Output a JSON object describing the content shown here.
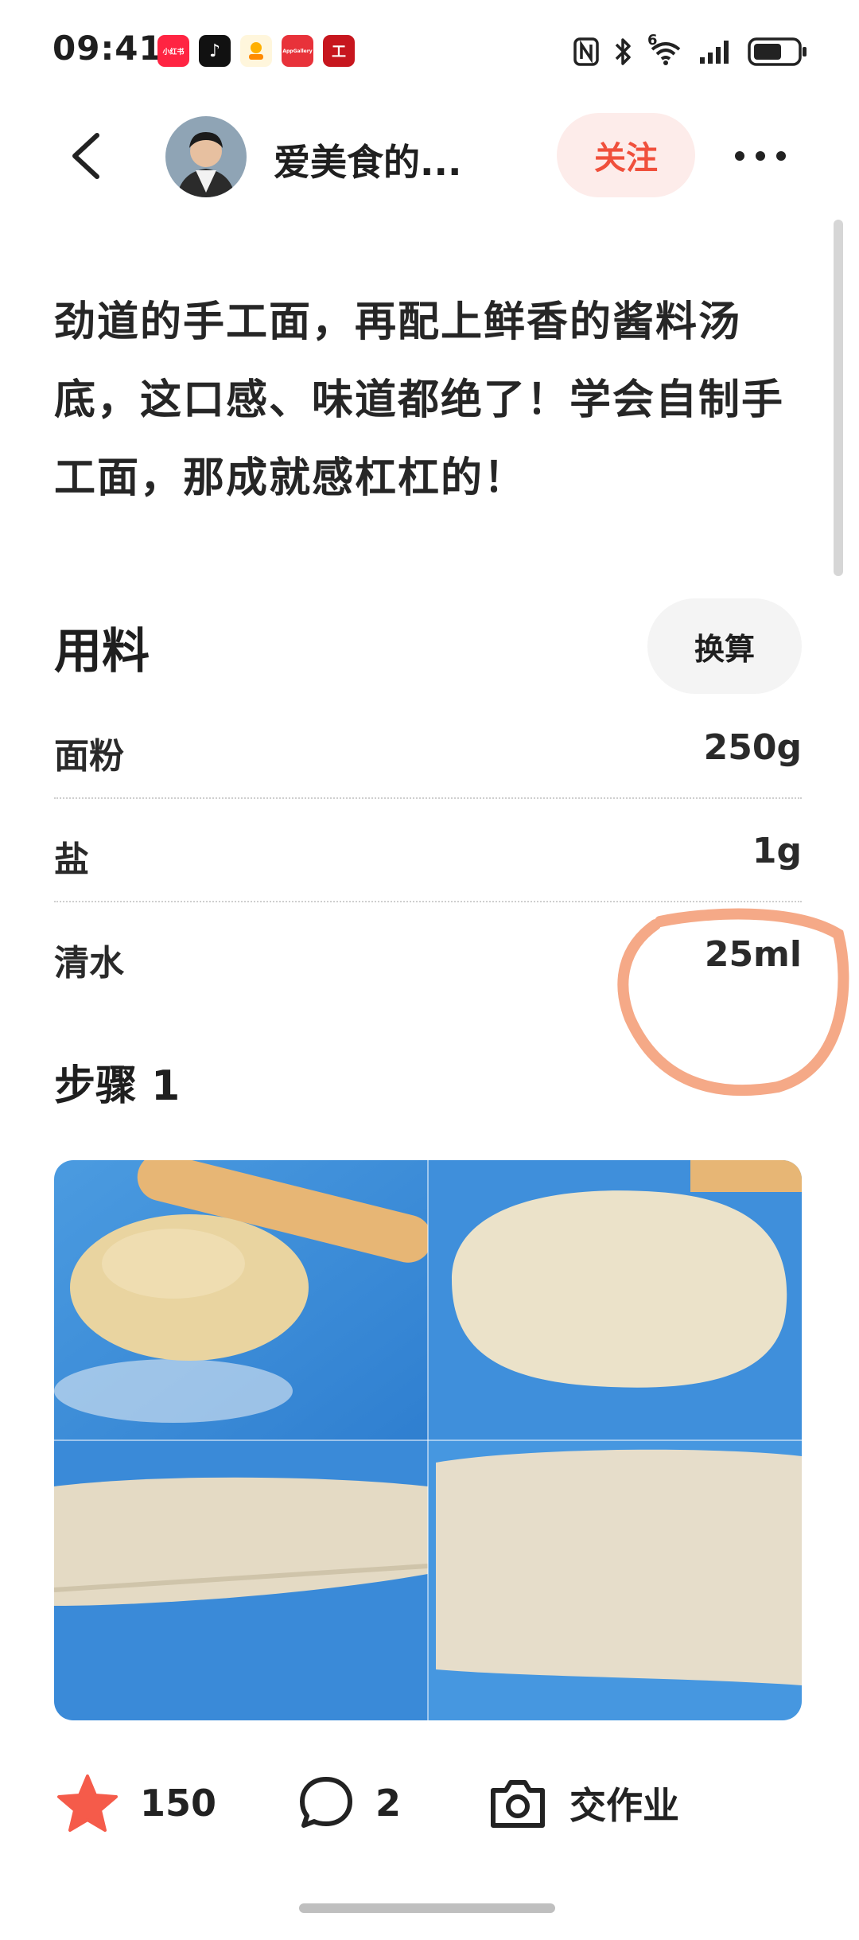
{
  "status_bar": {
    "time": "09:41",
    "apps": [
      {
        "name": "xiaohongshu",
        "label": "小红书",
        "color": "#ff2442"
      },
      {
        "name": "douyin",
        "label": "♪",
        "color": "#111111"
      },
      {
        "name": "meituan",
        "label": "",
        "color": "#ffc300"
      },
      {
        "name": "app-gallery",
        "label": "AppGallery",
        "color": "#e8323a"
      },
      {
        "name": "icbc",
        "label": "工",
        "color": "#c7161e"
      }
    ],
    "network_label": "6"
  },
  "header": {
    "author_name": "爱美食的...",
    "follow_label": "关注"
  },
  "recipe": {
    "description": "劲道的手工面，再配上鲜香的酱料汤底，这口感、味道都绝了！学会自制手工面，那成就感杠杠的！",
    "ingredients_title": "用料",
    "convert_label": "换算",
    "ingredients": [
      {
        "name": "面粉",
        "qty": "250g"
      },
      {
        "name": "盐",
        "qty": "1g"
      },
      {
        "name": "清水",
        "qty": "25ml"
      }
    ],
    "step_title": "步骤 1"
  },
  "bottom_bar": {
    "favorites_count": "150",
    "comments_count": "2",
    "homework_label": "交作业"
  },
  "colors": {
    "accent": "#f0503c",
    "follow_bg": "#fdecea",
    "annotation": "#f4a07a",
    "star": "#f55b4a"
  }
}
